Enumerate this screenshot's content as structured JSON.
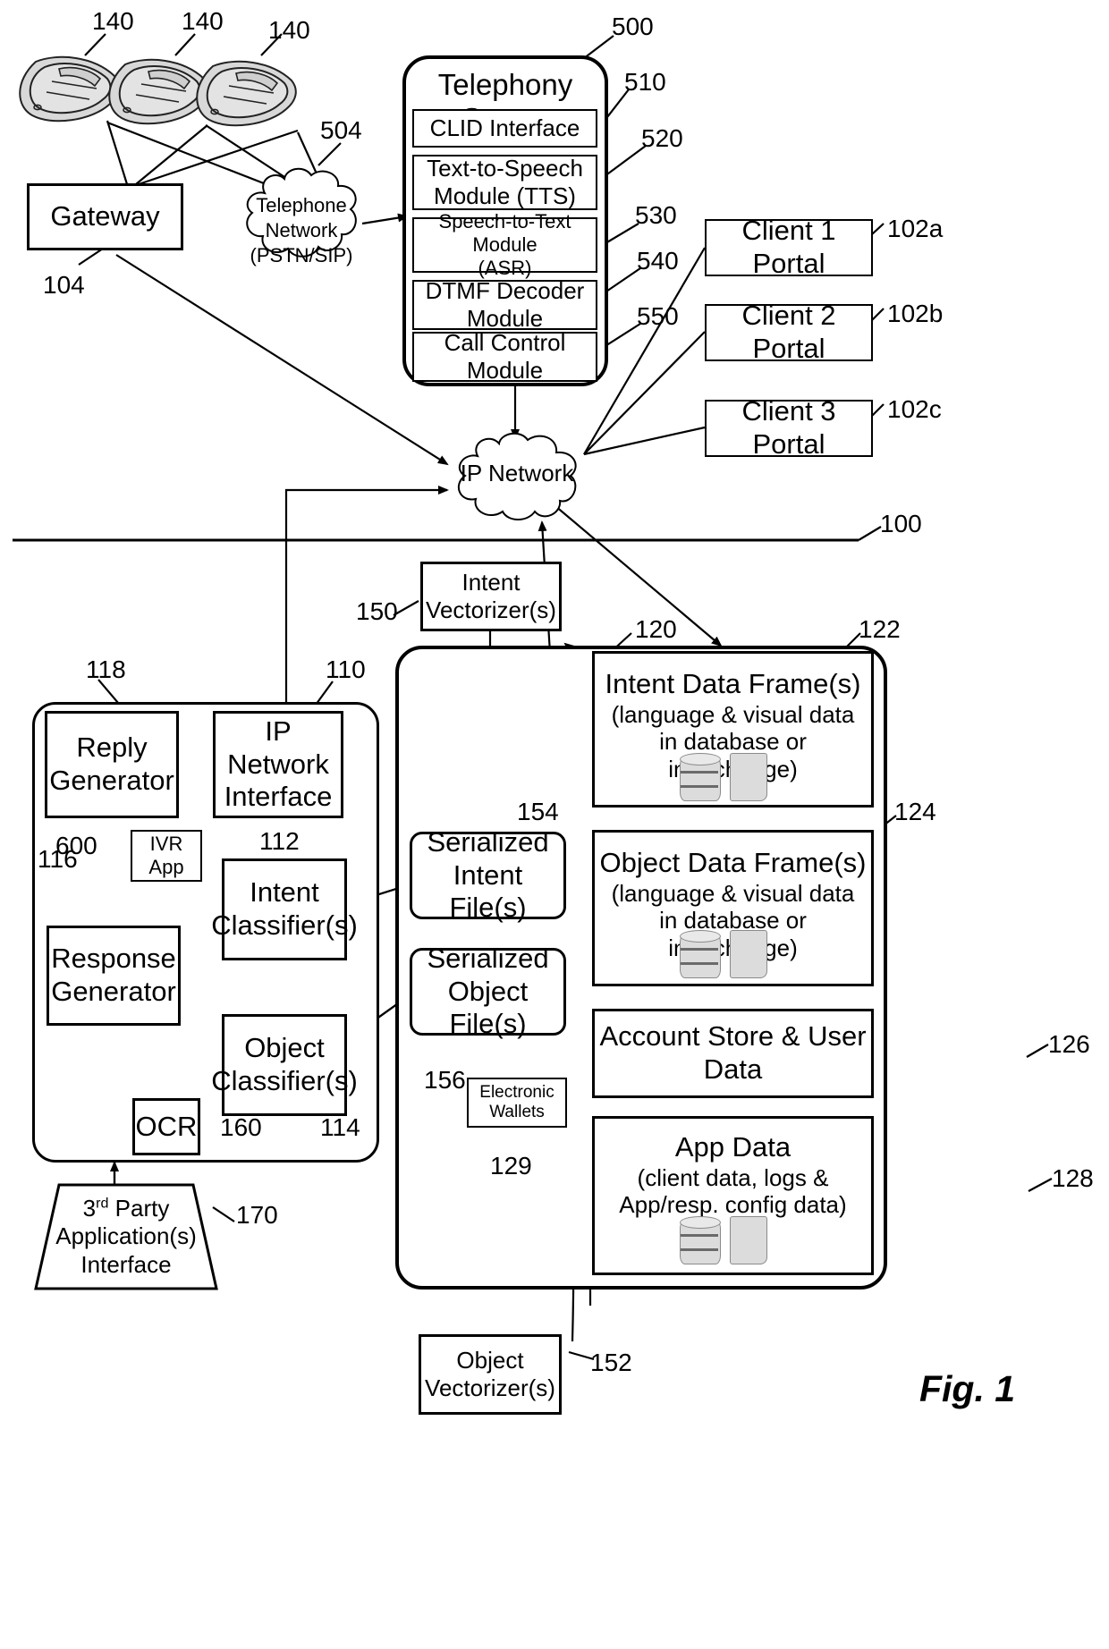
{
  "figure": {
    "caption": "Fig. 1"
  },
  "top_left": {
    "phone_refs": [
      "140",
      "140",
      "140"
    ],
    "gateway": {
      "label": "Gateway",
      "ref": "104"
    },
    "telephone_network": {
      "label": "Telephone\nNetwork\n(PSTN/SIP)",
      "line1": "Telephone",
      "line2": "Network",
      "line3": "(PSTN/SIP)",
      "ref": "504"
    }
  },
  "telephony_server": {
    "title": "Telephony Server",
    "ref": "500",
    "modules": [
      {
        "label": "CLID Interface",
        "ref": "510"
      },
      {
        "label": "Text-to-Speech\nModule (TTS)",
        "line1": "Text-to-Speech",
        "line2": "Module (TTS)",
        "ref": "520"
      },
      {
        "label": "Speech-to-Text Module\n(ASR)",
        "line1": "Speech-to-Text Module",
        "line2": "(ASR)",
        "ref": "530"
      },
      {
        "label": "DTMF Decoder\nModule",
        "line1": "DTMF Decoder",
        "line2": "Module",
        "ref": "540"
      },
      {
        "label": "Call Control\nModule",
        "line1": "Call Control",
        "line2": "Module",
        "ref": "550"
      }
    ]
  },
  "client_portals": [
    {
      "label": "Client 1 Portal",
      "ref": "102a"
    },
    {
      "label": "Client 2 Portal",
      "ref": "102b"
    },
    {
      "label": "Client 3 Portal",
      "ref": "102c"
    }
  ],
  "ip_network": {
    "label": "IP Network"
  },
  "system_ref": "100",
  "vectorizers": {
    "intent": {
      "line1": "Intent",
      "line2": "Vectorizer(s)",
      "ref": "150"
    },
    "object": {
      "line1": "Object",
      "line2": "Vectorizer(s)",
      "ref": "152"
    }
  },
  "server_block": {
    "ref": "118",
    "ip_network_interface": {
      "line1": "IP Network",
      "line2": "Interface",
      "ref": "110"
    },
    "reply_generator": {
      "line1": "Reply",
      "line2": "Generator"
    },
    "ivr_app": {
      "line1": "IVR",
      "line2": "App",
      "ref": "600"
    },
    "response_generator": {
      "line1": "Response",
      "line2": "Generator",
      "ref": "116"
    },
    "intent_classifier": {
      "line1": "Intent",
      "line2": "Classifier(s)",
      "ref": "112"
    },
    "object_classifier": {
      "line1": "Object",
      "line2": "Classifier(s)",
      "ref": "114"
    },
    "ocr": {
      "label": "OCR",
      "ref": "160"
    }
  },
  "third_party": {
    "line1": "3rd Party",
    "line1_sup": "rd",
    "line1_a": "3",
    "line1_b": " Party",
    "line2": "Application(s)",
    "line3": "Interface",
    "ref": "170"
  },
  "serialized": {
    "intent_file": {
      "line1": "Serialized",
      "line2": "Intent File(s)",
      "ref": "154"
    },
    "object_file": {
      "line1": "Serialized",
      "line2": "Object File(s)",
      "ref": "156"
    },
    "electronic_wallets": {
      "line1": "Electronic",
      "line2": "Wallets",
      "ref": "129"
    }
  },
  "data_store": {
    "ref": "120",
    "frames": [
      {
        "ref": "122",
        "line1": "Intent Data Frame(s)",
        "line2": "(language & visual data",
        "line3": "in database or interchange)",
        "has_icons": true
      },
      {
        "ref": "124",
        "line1": "Object Data Frame(s)",
        "line2": "(language & visual data",
        "line3": "in database or interchange)",
        "has_icons": true
      },
      {
        "ref": "126",
        "line1": "Account Store & User",
        "line2": "Data",
        "line3": "",
        "has_icons": false
      },
      {
        "ref": "128",
        "line1": "App Data",
        "line2": "(client data, logs &",
        "line3": "App/resp. config data)",
        "has_icons": true
      }
    ]
  },
  "colors": {
    "ink": "#000000",
    "paper": "#ffffff",
    "icon_fill": "#dcdcdc"
  }
}
